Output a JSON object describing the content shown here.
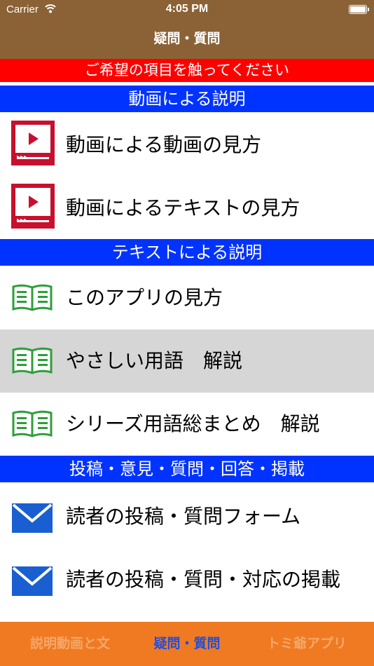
{
  "status_bar": {
    "carrier": "Carrier",
    "time": "4:05 PM"
  },
  "nav": {
    "title": "疑問・質問"
  },
  "instruction": "ご希望の項目を触ってください",
  "sections": [
    {
      "header": "動画による説明",
      "items": [
        {
          "icon": "video-icon",
          "label": "動画による動画の見方"
        },
        {
          "icon": "video-icon",
          "label": "動画によるテキストの見方"
        }
      ]
    },
    {
      "header": "テキストによる説明",
      "items": [
        {
          "icon": "book-icon",
          "label": "このアプリの見方"
        },
        {
          "icon": "book-icon",
          "label": "やさしい用語　解説",
          "selected": true
        },
        {
          "icon": "book-icon",
          "label": "シリーズ用語総まとめ　解説"
        }
      ]
    },
    {
      "header": "投稿・意見・質問・回答・掲載",
      "items": [
        {
          "icon": "mail-icon",
          "label": "読者の投稿・質問フォーム"
        },
        {
          "icon": "mail-icon",
          "label": "読者の投稿・質問・対応の掲載"
        }
      ]
    }
  ],
  "tabs": [
    {
      "label": "説明動画と文",
      "active": false
    },
    {
      "label": "疑問・質問",
      "active": true
    },
    {
      "label": "トミ爺アプリ",
      "active": false
    }
  ],
  "colors": {
    "header_bg": "#8b6236",
    "instruction_bg": "#ff0000",
    "section_bg": "#0033ff",
    "tabbar_bg": "#f07a22",
    "tab_active": "#1f4fe0",
    "video_red": "#c8102e",
    "book_green": "#2e9e3a",
    "mail_blue": "#1a5fd1",
    "selected_row": "#d6d6d6"
  }
}
